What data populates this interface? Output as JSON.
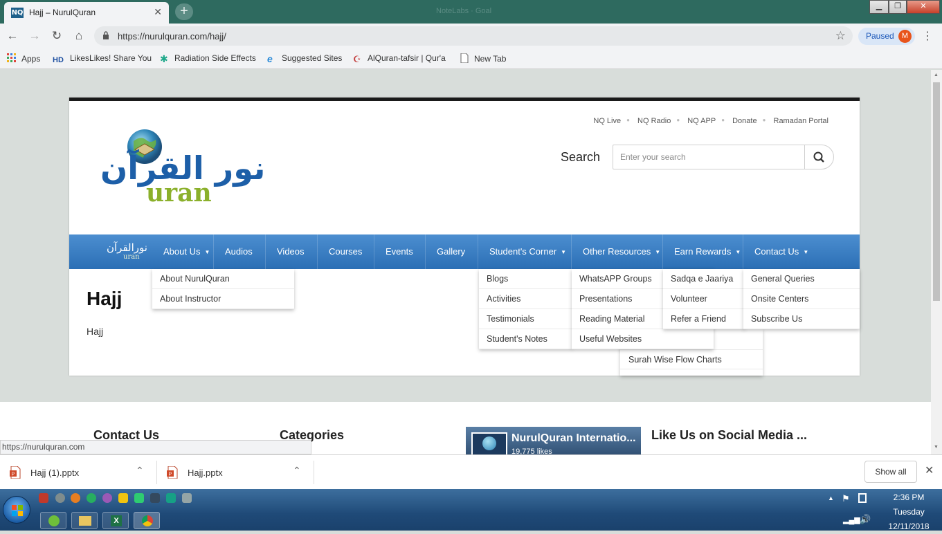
{
  "browser": {
    "tab_title": "Hajj – NurulQuran",
    "tab_favicon_text": "NQ",
    "window_title": "NoteLabs · Goal",
    "url": "https://nurulquran.com/hajj/",
    "profile_status": "Paused",
    "profile_initial": "M",
    "status_url": "https://nurulquran.com"
  },
  "bookmarks": [
    {
      "label": "Apps",
      "icon": "apps-grid-icon"
    },
    {
      "label": "LikesLikes! Share You",
      "icon": "hd-icon"
    },
    {
      "label": "Radiation Side Effects",
      "icon": "star-burst-icon"
    },
    {
      "label": "Suggested Sites",
      "icon": "ie-icon"
    },
    {
      "label": "AlQuran-tafsir | Qur'a",
      "icon": "quran-icon"
    },
    {
      "label": "New Tab",
      "icon": "page-icon"
    }
  ],
  "site": {
    "top_links": [
      "NQ Live",
      "NQ Radio",
      "NQ APP",
      "Donate",
      "Ramadan Portal"
    ],
    "search_label": "Search",
    "search_placeholder": "Enter your search",
    "logo_arabic": "نور القرآن",
    "logo_latin": "uran",
    "nav_logo_arabic": "نورالقرآن",
    "nav_logo_latin": "uran",
    "nav": [
      {
        "label": "About Us",
        "dropdown": true
      },
      {
        "label": "Audios",
        "dropdown": false
      },
      {
        "label": "Videos",
        "dropdown": false
      },
      {
        "label": "Courses",
        "dropdown": false
      },
      {
        "label": "Events",
        "dropdown": false
      },
      {
        "label": "Gallery",
        "dropdown": false
      },
      {
        "label": "Student's Corner",
        "dropdown": true
      },
      {
        "label": "Other Resources",
        "dropdown": true
      },
      {
        "label": "Earn Rewards",
        "dropdown": true
      },
      {
        "label": "Contact Us",
        "dropdown": true
      }
    ],
    "menus": {
      "about": [
        "About NurulQuran",
        "About Instructor"
      ],
      "students": [
        "Blogs",
        "Activities",
        "Testimonials",
        "Student's Notes"
      ],
      "resources": [
        "WhatsAPP Groups",
        "Presentations",
        "Reading Material",
        "Useful Websites"
      ],
      "resources_sub": "Surah Wise Flow Charts",
      "rewards": [
        "Sadqa e Jaariya",
        "Volunteer",
        "Refer a Friend"
      ],
      "contact": [
        "General Queries",
        "Onsite Centers",
        "Subscribe Us"
      ]
    },
    "page_title": "Hajj",
    "page_body": "Hajj"
  },
  "footer": {
    "contact_heading": "Contact Us",
    "categories_heading": "Categories",
    "fb_name": "NurulQuran Internatio...",
    "fb_likes": "19,775 likes",
    "social_heading": "Like Us on Social Media ..."
  },
  "downloads": {
    "items": [
      "Hajj (1).pptx",
      "Hajj.pptx"
    ],
    "show_all": "Show all"
  },
  "taskbar": {
    "time": "2:36 PM",
    "day": "Tuesday",
    "date": "12/11/2018"
  },
  "colors": {
    "tab_strip": "#2e6a5f",
    "nav_blue": "#2b6fb5",
    "logo_blue": "#1d5fa8",
    "logo_green": "#8bb02b"
  }
}
